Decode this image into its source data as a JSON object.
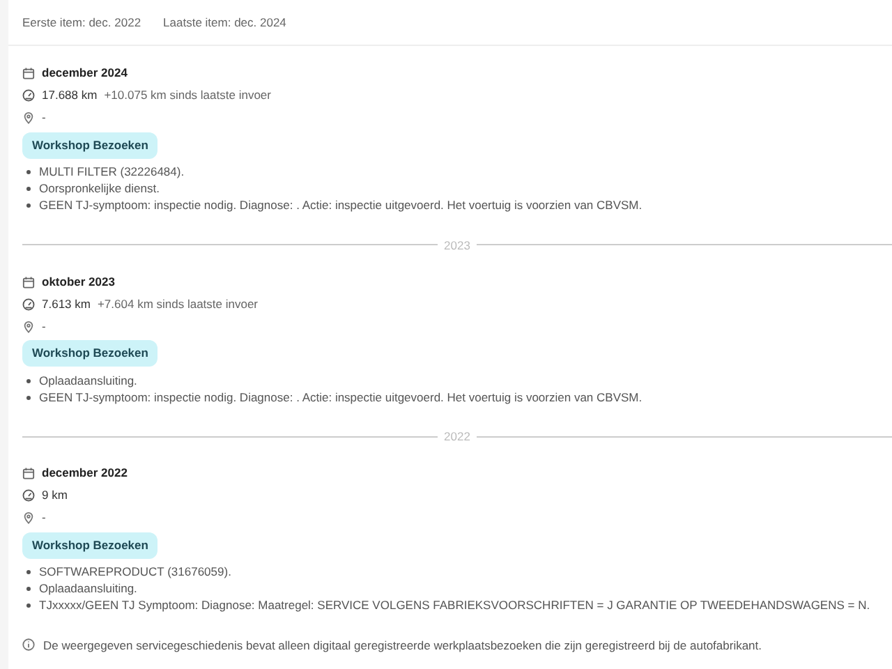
{
  "summary": {
    "first_item": "Eerste item: dec. 2022",
    "last_item": "Laatste item: dec. 2024"
  },
  "entries": [
    {
      "date": "december 2024",
      "mileage": "17.688 km",
      "mileage_delta": "+10.075 km sinds laatste invoer",
      "location": "-",
      "badge": "Workshop Bezoeken",
      "notes": [
        "MULTI FILTER (32226484).",
        "Oorspronkelijke dienst.",
        "GEEN TJ-symptoom: inspectie nodig. Diagnose: . Actie: inspectie uitgevoerd. Het voertuig is voorzien van CBVSM."
      ]
    },
    {
      "year_divider": "2023",
      "date": "oktober 2023",
      "mileage": "7.613 km",
      "mileage_delta": "+7.604 km sinds laatste invoer",
      "location": "-",
      "badge": "Workshop Bezoeken",
      "notes": [
        "Oplaadaansluiting.",
        "GEEN TJ-symptoom: inspectie nodig. Diagnose: . Actie: inspectie uitgevoerd. Het voertuig is voorzien van CBVSM."
      ]
    },
    {
      "year_divider": "2022",
      "date": "december 2022",
      "mileage": "9 km",
      "location": "-",
      "badge": "Workshop Bezoeken",
      "notes": [
        "SOFTWAREPRODUCT (31676059).",
        "Oplaadaansluiting.",
        "TJxxxxx/GEEN TJ Symptoom: Diagnose: Maatregel: SERVICE VOLGENS FABRIEKSVOORSCHRIFTEN = J GARANTIE OP TWEEDEHANDSWAGENS = N."
      ]
    }
  ],
  "disclaimer": "De weergegeven servicegeschiedenis bevat alleen digitaal geregistreerde werkplaatsbezoeken die zijn geregistreerd bij de autofabrikant."
}
